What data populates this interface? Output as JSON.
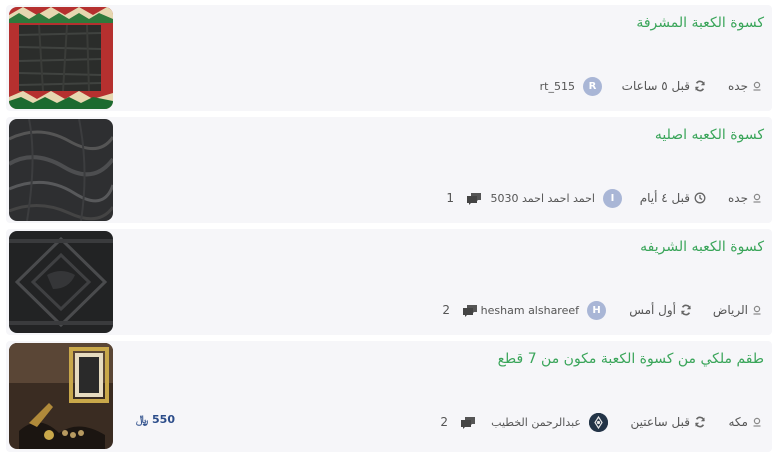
{
  "listings": [
    {
      "title": "كسوة الكعبة المشرفة",
      "city": "جده",
      "time": "قبل ٥ ساعات",
      "time_icon": "refresh-icon",
      "user": "rt_515",
      "avatar_letter": "R",
      "comments": "",
      "price": ""
    },
    {
      "title": "كسوة الكعبه اصليه",
      "city": "جده",
      "time": "قبل ٤ أيام",
      "time_icon": "clock-icon",
      "user": "احمد احمد احمد 5030",
      "avatar_letter": "I",
      "comments": "1",
      "price": ""
    },
    {
      "title": "كسوة الكعبه الشريفه",
      "city": "الرياض",
      "time": "أول أمس",
      "time_icon": "refresh-icon",
      "user": "hesham alshareef",
      "avatar_letter": "H",
      "comments": "2",
      "price": ""
    },
    {
      "title": "طقم ملكي من كسوة الكعبة مكون من 7 قطع",
      "city": "مكه",
      "time": "قبل ساعتين",
      "time_icon": "refresh-icon",
      "user": "عبدالرحمن الخطيب",
      "avatar_letter": "",
      "comments": "2",
      "price": "550 ﷼"
    }
  ],
  "colors": {
    "title_green": "#3aa55a",
    "card_bg": "#f6f6f9",
    "avatar_bg": "#a9b6d6",
    "price_blue": "#2c4d8a"
  }
}
